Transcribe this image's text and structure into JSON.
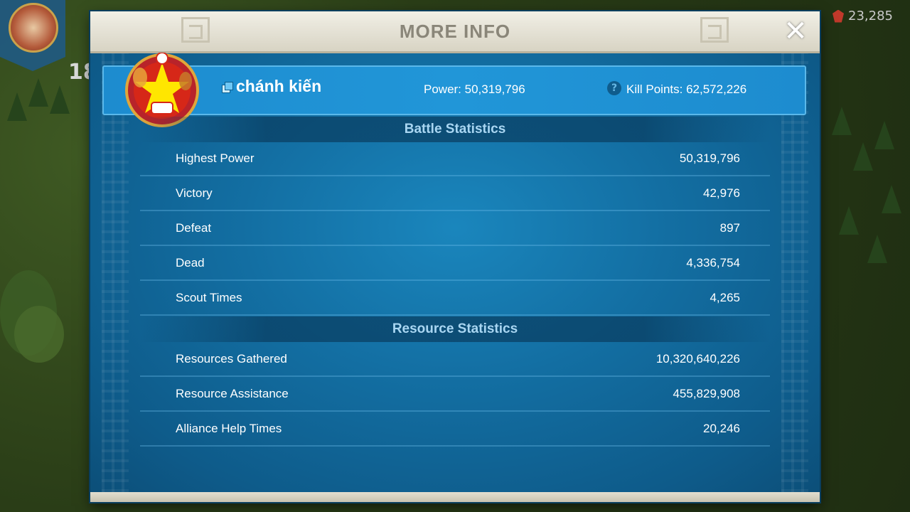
{
  "hud": {
    "level": "18",
    "gems": "23,285"
  },
  "dialog": {
    "title": "MORE INFO",
    "close_symbol": "✕"
  },
  "player": {
    "name": "chánh  kiến",
    "power": "Power: 50,319,796",
    "kill_points": "Kill Points: 62,572,226",
    "help_symbol": "?",
    "emblem_icon": "vietnam-star-emblem-icon",
    "colors": {
      "emblem_red": "#d62718",
      "emblem_star": "#ffe600"
    }
  },
  "battle": {
    "title": "Battle Statistics",
    "rows": [
      {
        "label": "Highest Power",
        "value": "50,319,796"
      },
      {
        "label": "Victory",
        "value": "42,976"
      },
      {
        "label": "Defeat",
        "value": "897"
      },
      {
        "label": "Dead",
        "value": "4,336,754"
      },
      {
        "label": "Scout Times",
        "value": "4,265"
      }
    ]
  },
  "resource": {
    "title": "Resource Statistics",
    "rows": [
      {
        "label": "Resources Gathered",
        "value": "10,320,640,226"
      },
      {
        "label": "Resource Assistance",
        "value": "455,829,908"
      },
      {
        "label": "Alliance Help Times",
        "value": "20,246"
      }
    ]
  }
}
